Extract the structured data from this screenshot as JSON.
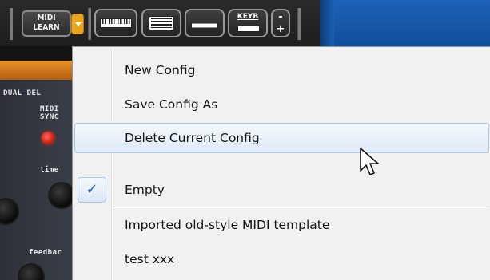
{
  "toolbar": {
    "midi_learn_label": "MIDI\nLEARN",
    "keyb_label": "KEYB",
    "plusminus_label": "-\n+",
    "icons": [
      "dropdown-arrow-icon",
      "keyboard-full-icon",
      "keyboard-compact-icon",
      "keyboard-bar-icon",
      "keyboard-toggle-icon",
      "zoom-icon"
    ]
  },
  "panel": {
    "title": "DUAL DEL",
    "midi_sync_label": "MIDI\nSYNC",
    "time_label": "time",
    "feedback_label": "feedbac"
  },
  "menu": {
    "items": [
      {
        "label": "New Config",
        "highlighted": false,
        "checked": false
      },
      {
        "label": "Save Config As",
        "highlighted": false,
        "checked": false
      },
      {
        "label": "Delete Current Config",
        "highlighted": true,
        "checked": false
      },
      {
        "label": "Empty",
        "highlighted": false,
        "checked": true
      },
      {
        "label": "Imported old-style MIDI template",
        "highlighted": false,
        "checked": false
      },
      {
        "label": "test xxx",
        "highlighted": false,
        "checked": false
      }
    ],
    "check_glyph": "✓"
  },
  "colors": {
    "accent_orange": "#e8a51c",
    "led_red": "#d21e10",
    "highlight_border": "#a8c8ec",
    "blue_panel": "#1c62b8"
  }
}
